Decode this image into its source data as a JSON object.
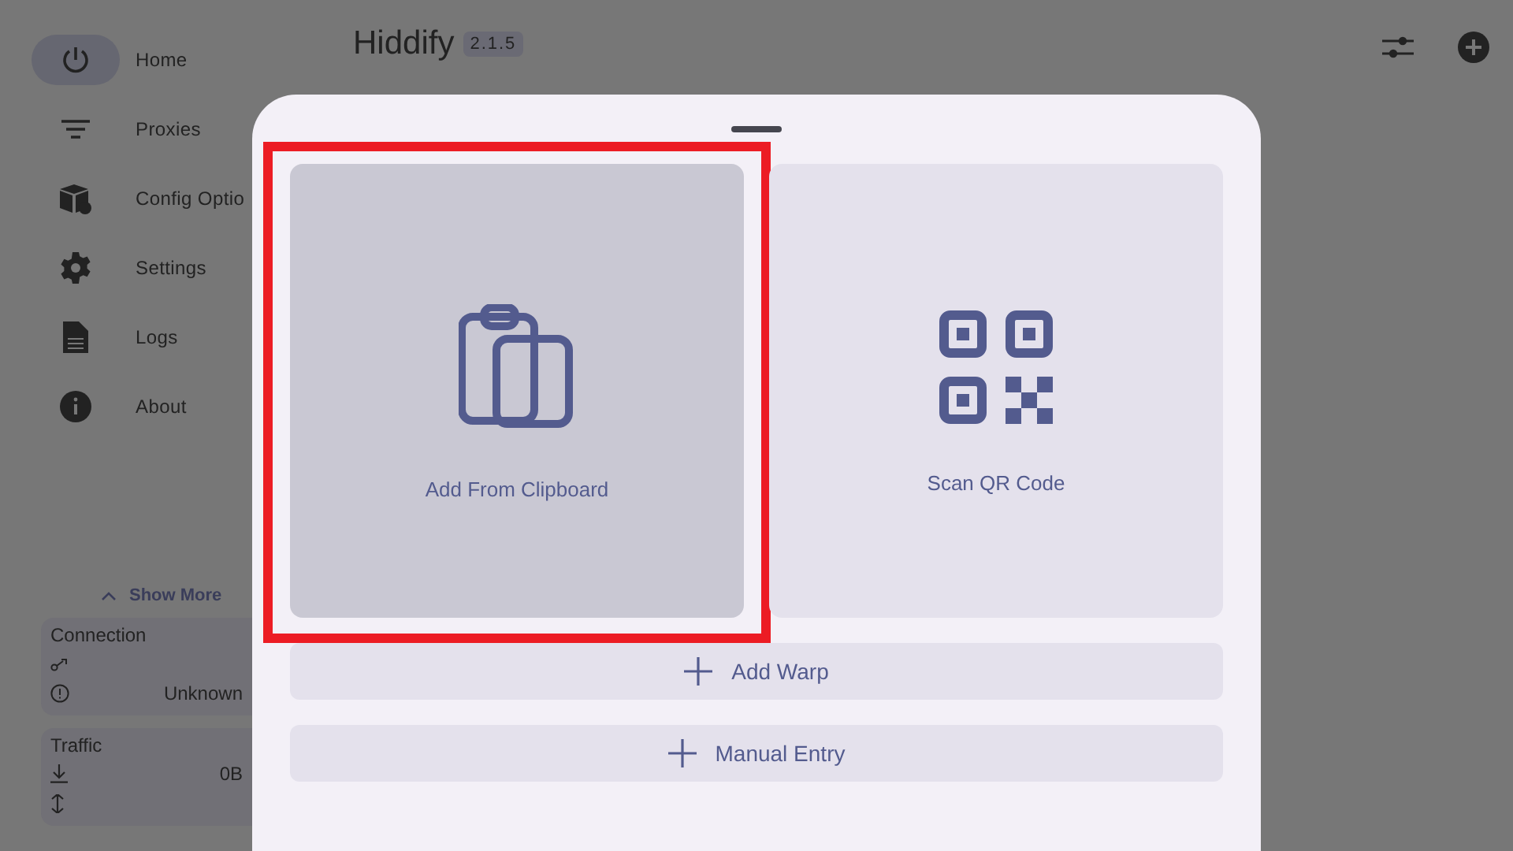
{
  "app": {
    "title": "Hiddify",
    "version": "2.1.5"
  },
  "sidebar": {
    "items": [
      {
        "label": "Home",
        "selected": true
      },
      {
        "label": "Proxies",
        "selected": false
      },
      {
        "label": "Config Optio",
        "selected": false
      },
      {
        "label": "Settings",
        "selected": false
      },
      {
        "label": "Logs",
        "selected": false
      },
      {
        "label": "About",
        "selected": false
      }
    ],
    "show_more": "Show More",
    "connection": {
      "title": "Connection",
      "status": "Unknown"
    },
    "traffic": {
      "title": "Traffic",
      "download": "0B"
    }
  },
  "sheet": {
    "tiles": [
      {
        "label": "Add From Clipboard",
        "selected": true,
        "highlighted": true
      },
      {
        "label": "Scan QR Code",
        "selected": false,
        "highlighted": false
      }
    ],
    "buttons": [
      {
        "label": "Add Warp"
      },
      {
        "label": "Manual Entry"
      }
    ]
  }
}
